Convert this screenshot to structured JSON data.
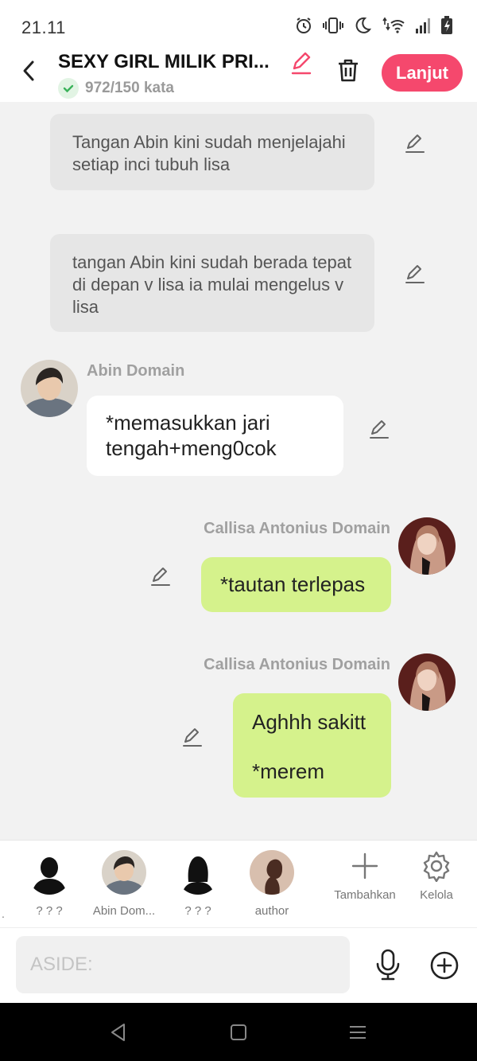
{
  "status": {
    "time": "21.11"
  },
  "header": {
    "title": "SEXY GIRL MILIK PRI...",
    "word_count": "972/150 kata",
    "next_label": "Lanjut"
  },
  "messages": {
    "aside1": "Tangan Abin kini sudah menjelajahi setiap inci tubuh lisa",
    "aside2": "tangan Abin kini sudah berada tepat di depan v lisa ia mulai mengelus v lisa",
    "abin_name": "Abin Domain",
    "abin_text": "*memasukkan jari tengah+meng0cok",
    "callisa_name1": "Callisa Antonius Domain",
    "callisa_text1": "*tautan terlepas",
    "callisa_name2": "Callisa Antonius Domain",
    "callisa_text2_line1": "Aghhh sakitt",
    "callisa_text2_line2": "*merem"
  },
  "cast": {
    "items": [
      {
        "label": "? ? ?"
      },
      {
        "label": "Abin Dom..."
      },
      {
        "label": "? ? ?"
      },
      {
        "label": "author"
      }
    ],
    "add_label": "Tambahkan",
    "manage_label": "Kelola",
    "edge_mark": "."
  },
  "composer": {
    "placeholder": "ASIDE:"
  },
  "colors": {
    "accent": "#f5486d",
    "green_bubble": "#d5f28c",
    "aside_bg": "#e6e6e6"
  }
}
